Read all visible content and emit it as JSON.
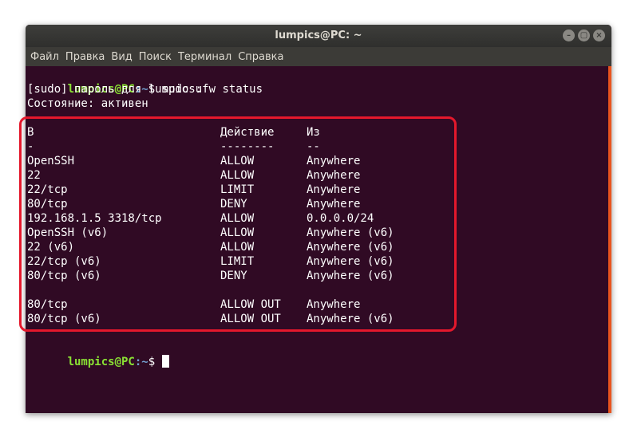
{
  "window": {
    "title": "lumpics@PC: ~",
    "buttons": [
      "–",
      "▢",
      "×"
    ]
  },
  "menu": [
    "Файл",
    "Правка",
    "Вид",
    "Поиск",
    "Терминал",
    "Справка"
  ],
  "prompt": {
    "user": "lumpics@PC",
    "path": ":~",
    "symbol": "$"
  },
  "command": " sudo ufw status",
  "sudo_line": "[sudo] пароль для lumpics:",
  "status_line": "Состояние: активен",
  "table": {
    "headers": [
      "В",
      "Действие",
      "Из"
    ],
    "separators": [
      "-",
      "--------",
      "--"
    ],
    "rows": [
      [
        "OpenSSH",
        "ALLOW",
        "Anywhere"
      ],
      [
        "22",
        "ALLOW",
        "Anywhere"
      ],
      [
        "22/tcp",
        "LIMIT",
        "Anywhere"
      ],
      [
        "80/tcp",
        "DENY",
        "Anywhere"
      ],
      [
        "192.168.1.5 3318/tcp",
        "ALLOW",
        "0.0.0.0/24"
      ],
      [
        "OpenSSH (v6)",
        "ALLOW",
        "Anywhere (v6)"
      ],
      [
        "22 (v6)",
        "ALLOW",
        "Anywhere (v6)"
      ],
      [
        "22/tcp (v6)",
        "LIMIT",
        "Anywhere (v6)"
      ],
      [
        "80/tcp (v6)",
        "DENY",
        "Anywhere (v6)"
      ]
    ],
    "out_rows": [
      [
        "80/tcp",
        "ALLOW OUT",
        "Anywhere"
      ],
      [
        "80/tcp (v6)",
        "ALLOW OUT",
        "Anywhere (v6)"
      ]
    ]
  },
  "colors": {
    "background": "#300a24",
    "prompt_user": "#8ae234",
    "prompt_path": "#729fcf",
    "highlight": "#e4182c"
  }
}
